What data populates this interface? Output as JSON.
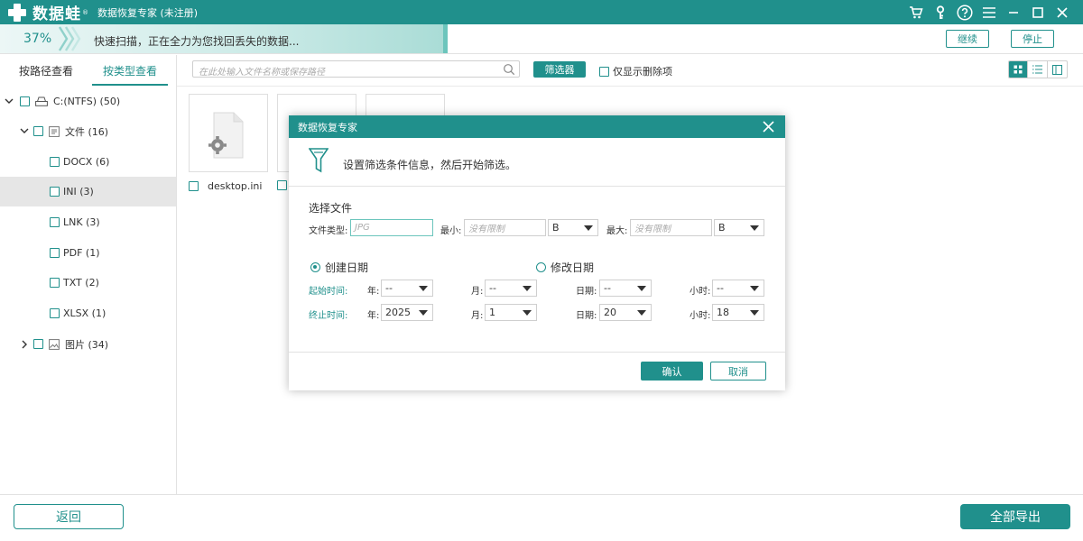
{
  "titlebar": {
    "logo_text": "数据蛙",
    "logo_reg": "®",
    "app_title": "数据恢复专家 (未注册)"
  },
  "scan": {
    "progress_percent": 37,
    "progress_text": "37%",
    "message": "快速扫描，正在全力为您找回丢失的数据...",
    "continue_label": "继续",
    "stop_label": "停止"
  },
  "left": {
    "tabs": [
      "按路径查看",
      "按类型查看"
    ],
    "active_tab": 1,
    "tree": [
      {
        "label": "C:(NTFS) (50)",
        "level": 0,
        "expanded": true,
        "icon": "drive-icon"
      },
      {
        "label": "文件 (16)",
        "level": 1,
        "expanded": true,
        "icon": "document-icon"
      },
      {
        "label": "DOCX (6)",
        "level": 2
      },
      {
        "label": "INI (3)",
        "level": 2,
        "selected": true
      },
      {
        "label": "LNK (3)",
        "level": 2
      },
      {
        "label": "PDF (1)",
        "level": 2
      },
      {
        "label": "TXT (2)",
        "level": 2
      },
      {
        "label": "XLSX (1)",
        "level": 2
      },
      {
        "label": "图片 (34)",
        "level": 1,
        "expanded": false,
        "icon": "image-icon"
      }
    ]
  },
  "toolbar": {
    "search_placeholder": "在此处输入文件名称或保存路径",
    "filter_label": "筛选器",
    "only_deleted_label": "仅显示删除项"
  },
  "files": [
    {
      "name": "desktop.ini"
    },
    {
      "name": ""
    },
    {
      "name": ""
    }
  ],
  "footer": {
    "back_label": "返回",
    "export_all_label": "全部导出"
  },
  "dialog": {
    "title": "数据恢复专家",
    "header_text": "设置筛选条件信息，然后开始筛选。",
    "section_title": "选择文件",
    "file_type_label": "文件类型:",
    "file_type_placeholder": "JPG",
    "min_label": "最小:",
    "min_placeholder": "没有限制",
    "min_unit": "B",
    "max_label": "最大:",
    "max_placeholder": "没有限制",
    "max_unit": "B",
    "radio_created": "创建日期",
    "radio_modified": "修改日期",
    "date_mode": "created",
    "start_label": "起始时间:",
    "end_label": "终止时间:",
    "year_label": "年:",
    "month_label": "月:",
    "day_label": "日期:",
    "hour_label": "小时:",
    "start": {
      "year": "--",
      "month": "--",
      "day": "--",
      "hour": "--"
    },
    "end": {
      "year": "2025",
      "month": "1",
      "day": "20",
      "hour": "18"
    },
    "ok_label": "确认",
    "cancel_label": "取消"
  },
  "colors": {
    "accent": "#20908c",
    "progress_light": "#cdebe8",
    "selected_row": "#e6e6e6"
  }
}
